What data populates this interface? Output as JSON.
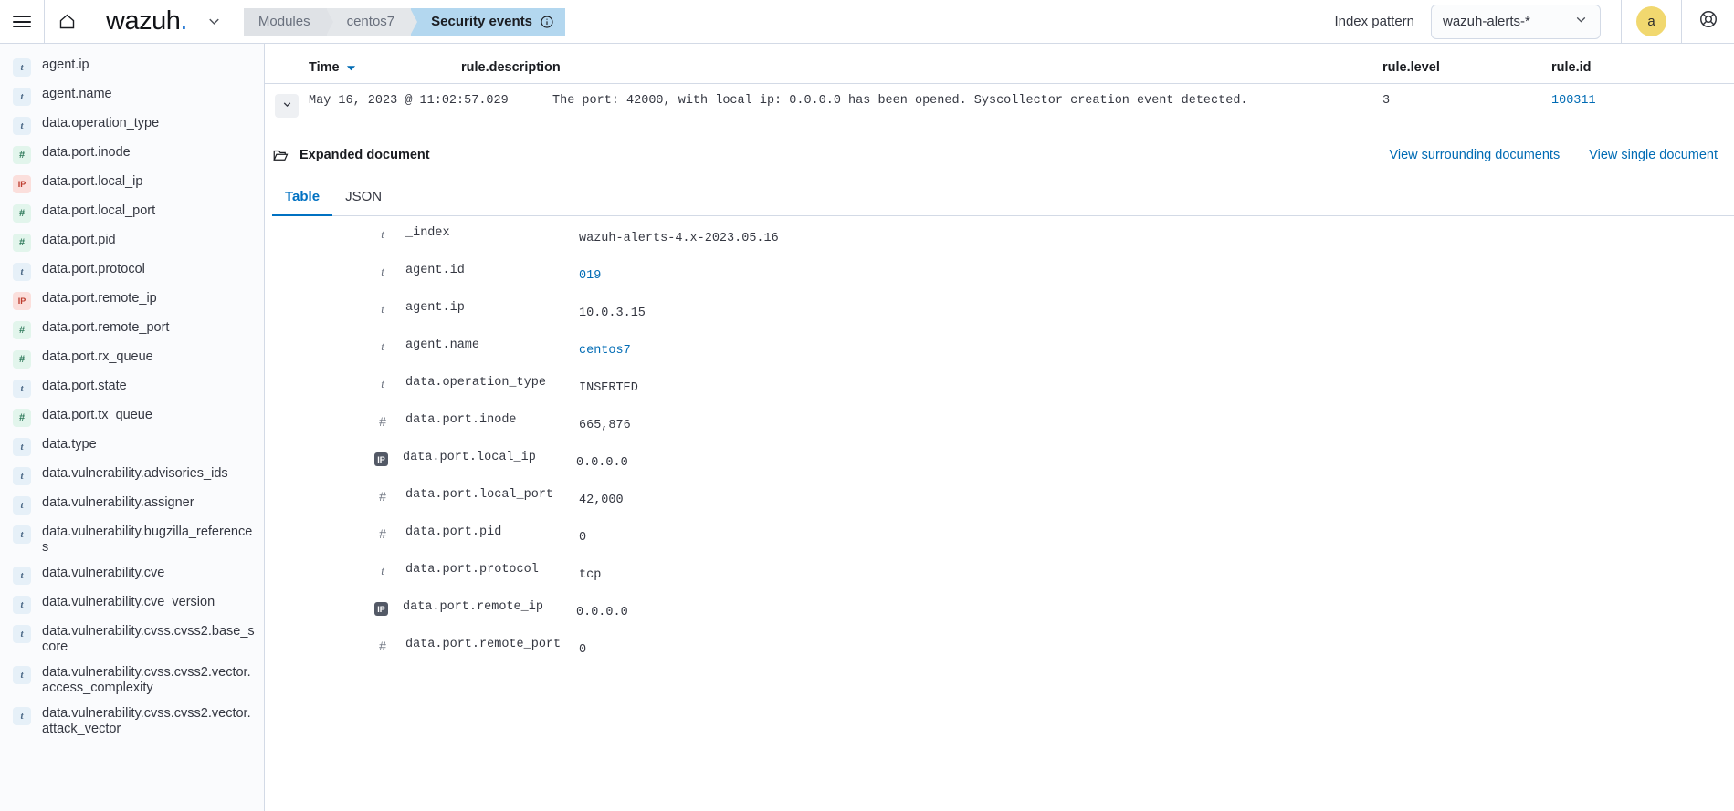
{
  "header": {
    "menu_icon": "hamburger-icon",
    "home_icon": "home-icon",
    "brand": "wazuh",
    "brand_dot": ".",
    "brand_caret_icon": "chevron-down-icon",
    "breadcrumbs": [
      {
        "label": "Modules",
        "active": false
      },
      {
        "label": "centos7",
        "active": false
      },
      {
        "label": "Security events",
        "active": true,
        "info_icon": "info-circle-icon"
      }
    ],
    "index_pattern_label": "Index pattern",
    "index_pattern_value": "wazuh-alerts-*",
    "index_pattern_caret_icon": "chevron-down-icon",
    "avatar_initial": "a",
    "help_icon": "lifebuoy-icon",
    "accent_color": "#006bb4",
    "active_crumb_color": "#b3d7ef"
  },
  "sidebar": {
    "fields": [
      {
        "type": "t",
        "name": "agent.ip"
      },
      {
        "type": "t",
        "name": "agent.name"
      },
      {
        "type": "t",
        "name": "data.operation_type"
      },
      {
        "type": "n",
        "name": "data.port.inode"
      },
      {
        "type": "ip",
        "name": "data.port.local_ip"
      },
      {
        "type": "n",
        "name": "data.port.local_port"
      },
      {
        "type": "n",
        "name": "data.port.pid"
      },
      {
        "type": "t",
        "name": "data.port.protocol"
      },
      {
        "type": "ip",
        "name": "data.port.remote_ip"
      },
      {
        "type": "n",
        "name": "data.port.remote_port"
      },
      {
        "type": "n",
        "name": "data.port.rx_queue"
      },
      {
        "type": "t",
        "name": "data.port.state"
      },
      {
        "type": "n",
        "name": "data.port.tx_queue"
      },
      {
        "type": "t",
        "name": "data.type"
      },
      {
        "type": "t",
        "name": "data.vulnerability.advisories_ids"
      },
      {
        "type": "t",
        "name": "data.vulnerability.assigner"
      },
      {
        "type": "t",
        "name": "data.vulnerability.bugzilla_references"
      },
      {
        "type": "t",
        "name": "data.vulnerability.cve"
      },
      {
        "type": "t",
        "name": "data.vulnerability.cve_version"
      },
      {
        "type": "t",
        "name": "data.vulnerability.cvss.cvss2.base_score"
      },
      {
        "type": "t",
        "name": "data.vulnerability.cvss.cvss2.vector.access_complexity"
      },
      {
        "type": "t",
        "name": "data.vulnerability.cvss.cvss2.vector.attack_vector"
      }
    ],
    "type_glyphs": {
      "t": "t",
      "n": "#",
      "ip": "IP"
    }
  },
  "main": {
    "columns": {
      "time": "Time",
      "description": "rule.description",
      "level": "rule.level",
      "id": "rule.id"
    },
    "sort_icon": "sort-descending-caret-icon",
    "row": {
      "expand_icon": "chevron-down-icon",
      "time": "May 16, 2023 @ 11:02:57.029",
      "description": "The port: 42000, with local ip: 0.0.0.0 has been opened. Syscollector creation event detected.",
      "level": "3",
      "id": "100311"
    },
    "expanded": {
      "folder_icon": "folder-open-icon",
      "title": "Expanded document",
      "links": [
        {
          "label": "View surrounding documents"
        },
        {
          "label": "View single document"
        }
      ],
      "tabs": [
        {
          "label": "Table",
          "selected": true
        },
        {
          "label": "JSON",
          "selected": false
        }
      ],
      "fields": [
        {
          "type": "t",
          "key": "_index",
          "value": "wazuh-alerts-4.x-2023.05.16",
          "link": false
        },
        {
          "type": "t",
          "key": "agent.id",
          "value": "019",
          "link": true
        },
        {
          "type": "t",
          "key": "agent.ip",
          "value": "10.0.3.15",
          "link": false
        },
        {
          "type": "t",
          "key": "agent.name",
          "value": "centos7",
          "link": true
        },
        {
          "type": "t",
          "key": "data.operation_type",
          "value": "INSERTED",
          "link": false
        },
        {
          "type": "n",
          "key": "data.port.inode",
          "value": "665,876",
          "link": false
        },
        {
          "type": "ip",
          "key": "data.port.local_ip",
          "value": "0.0.0.0",
          "link": false
        },
        {
          "type": "n",
          "key": "data.port.local_port",
          "value": "42,000",
          "link": false
        },
        {
          "type": "n",
          "key": "data.port.pid",
          "value": "0",
          "link": false
        },
        {
          "type": "t",
          "key": "data.port.protocol",
          "value": "tcp",
          "link": false
        },
        {
          "type": "ip",
          "key": "data.port.remote_ip",
          "value": "0.0.0.0",
          "link": false
        },
        {
          "type": "n",
          "key": "data.port.remote_port",
          "value": "0",
          "link": false
        }
      ]
    }
  }
}
